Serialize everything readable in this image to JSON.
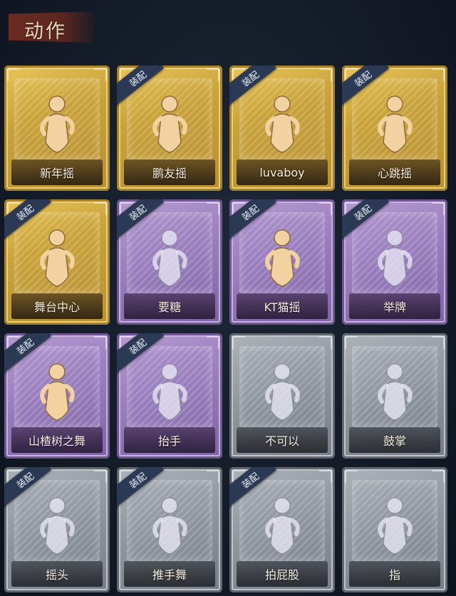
{
  "header": {
    "title": "动作"
  },
  "badge_label": "装配",
  "cards": [
    {
      "label": "新年摇",
      "rarity": "gold",
      "equipped": false,
      "icon": "newyear-shake-icon"
    },
    {
      "label": "鹏友摇",
      "rarity": "gold",
      "equipped": true,
      "icon": "friend-shake-icon"
    },
    {
      "label": "luvaboy",
      "rarity": "gold",
      "equipped": true,
      "icon": "luvaboy-icon"
    },
    {
      "label": "心跳摇",
      "rarity": "gold",
      "equipped": true,
      "icon": "heartbeat-shake-icon"
    },
    {
      "label": "舞台中心",
      "rarity": "gold",
      "equipped": true,
      "icon": "stage-center-icon"
    },
    {
      "label": "要糖",
      "rarity": "purple",
      "equipped": true,
      "icon": "ask-candy-icon"
    },
    {
      "label": "KT猫摇",
      "rarity": "purple",
      "equipped": true,
      "icon": "kt-cat-shake-icon"
    },
    {
      "label": "举牌",
      "rarity": "purple",
      "equipped": true,
      "icon": "hold-sign-icon"
    },
    {
      "label": "山楂树之舞",
      "rarity": "purple",
      "equipped": true,
      "icon": "hawthorn-dance-icon"
    },
    {
      "label": "抬手",
      "rarity": "purple",
      "equipped": true,
      "icon": "raise-hand-icon"
    },
    {
      "label": "不可以",
      "rarity": "gray",
      "equipped": false,
      "icon": "finger-no-icon"
    },
    {
      "label": "鼓掌",
      "rarity": "gray",
      "equipped": false,
      "icon": "clap-icon"
    },
    {
      "label": "摇头",
      "rarity": "gray",
      "equipped": true,
      "icon": "shake-head-icon"
    },
    {
      "label": "推手舞",
      "rarity": "gray",
      "equipped": true,
      "icon": "push-hand-dance-icon"
    },
    {
      "label": "拍屁股",
      "rarity": "gray",
      "equipped": true,
      "icon": "pat-butt-icon"
    },
    {
      "label": "指",
      "rarity": "gray",
      "equipped": false,
      "icon": "point-icon"
    }
  ]
}
